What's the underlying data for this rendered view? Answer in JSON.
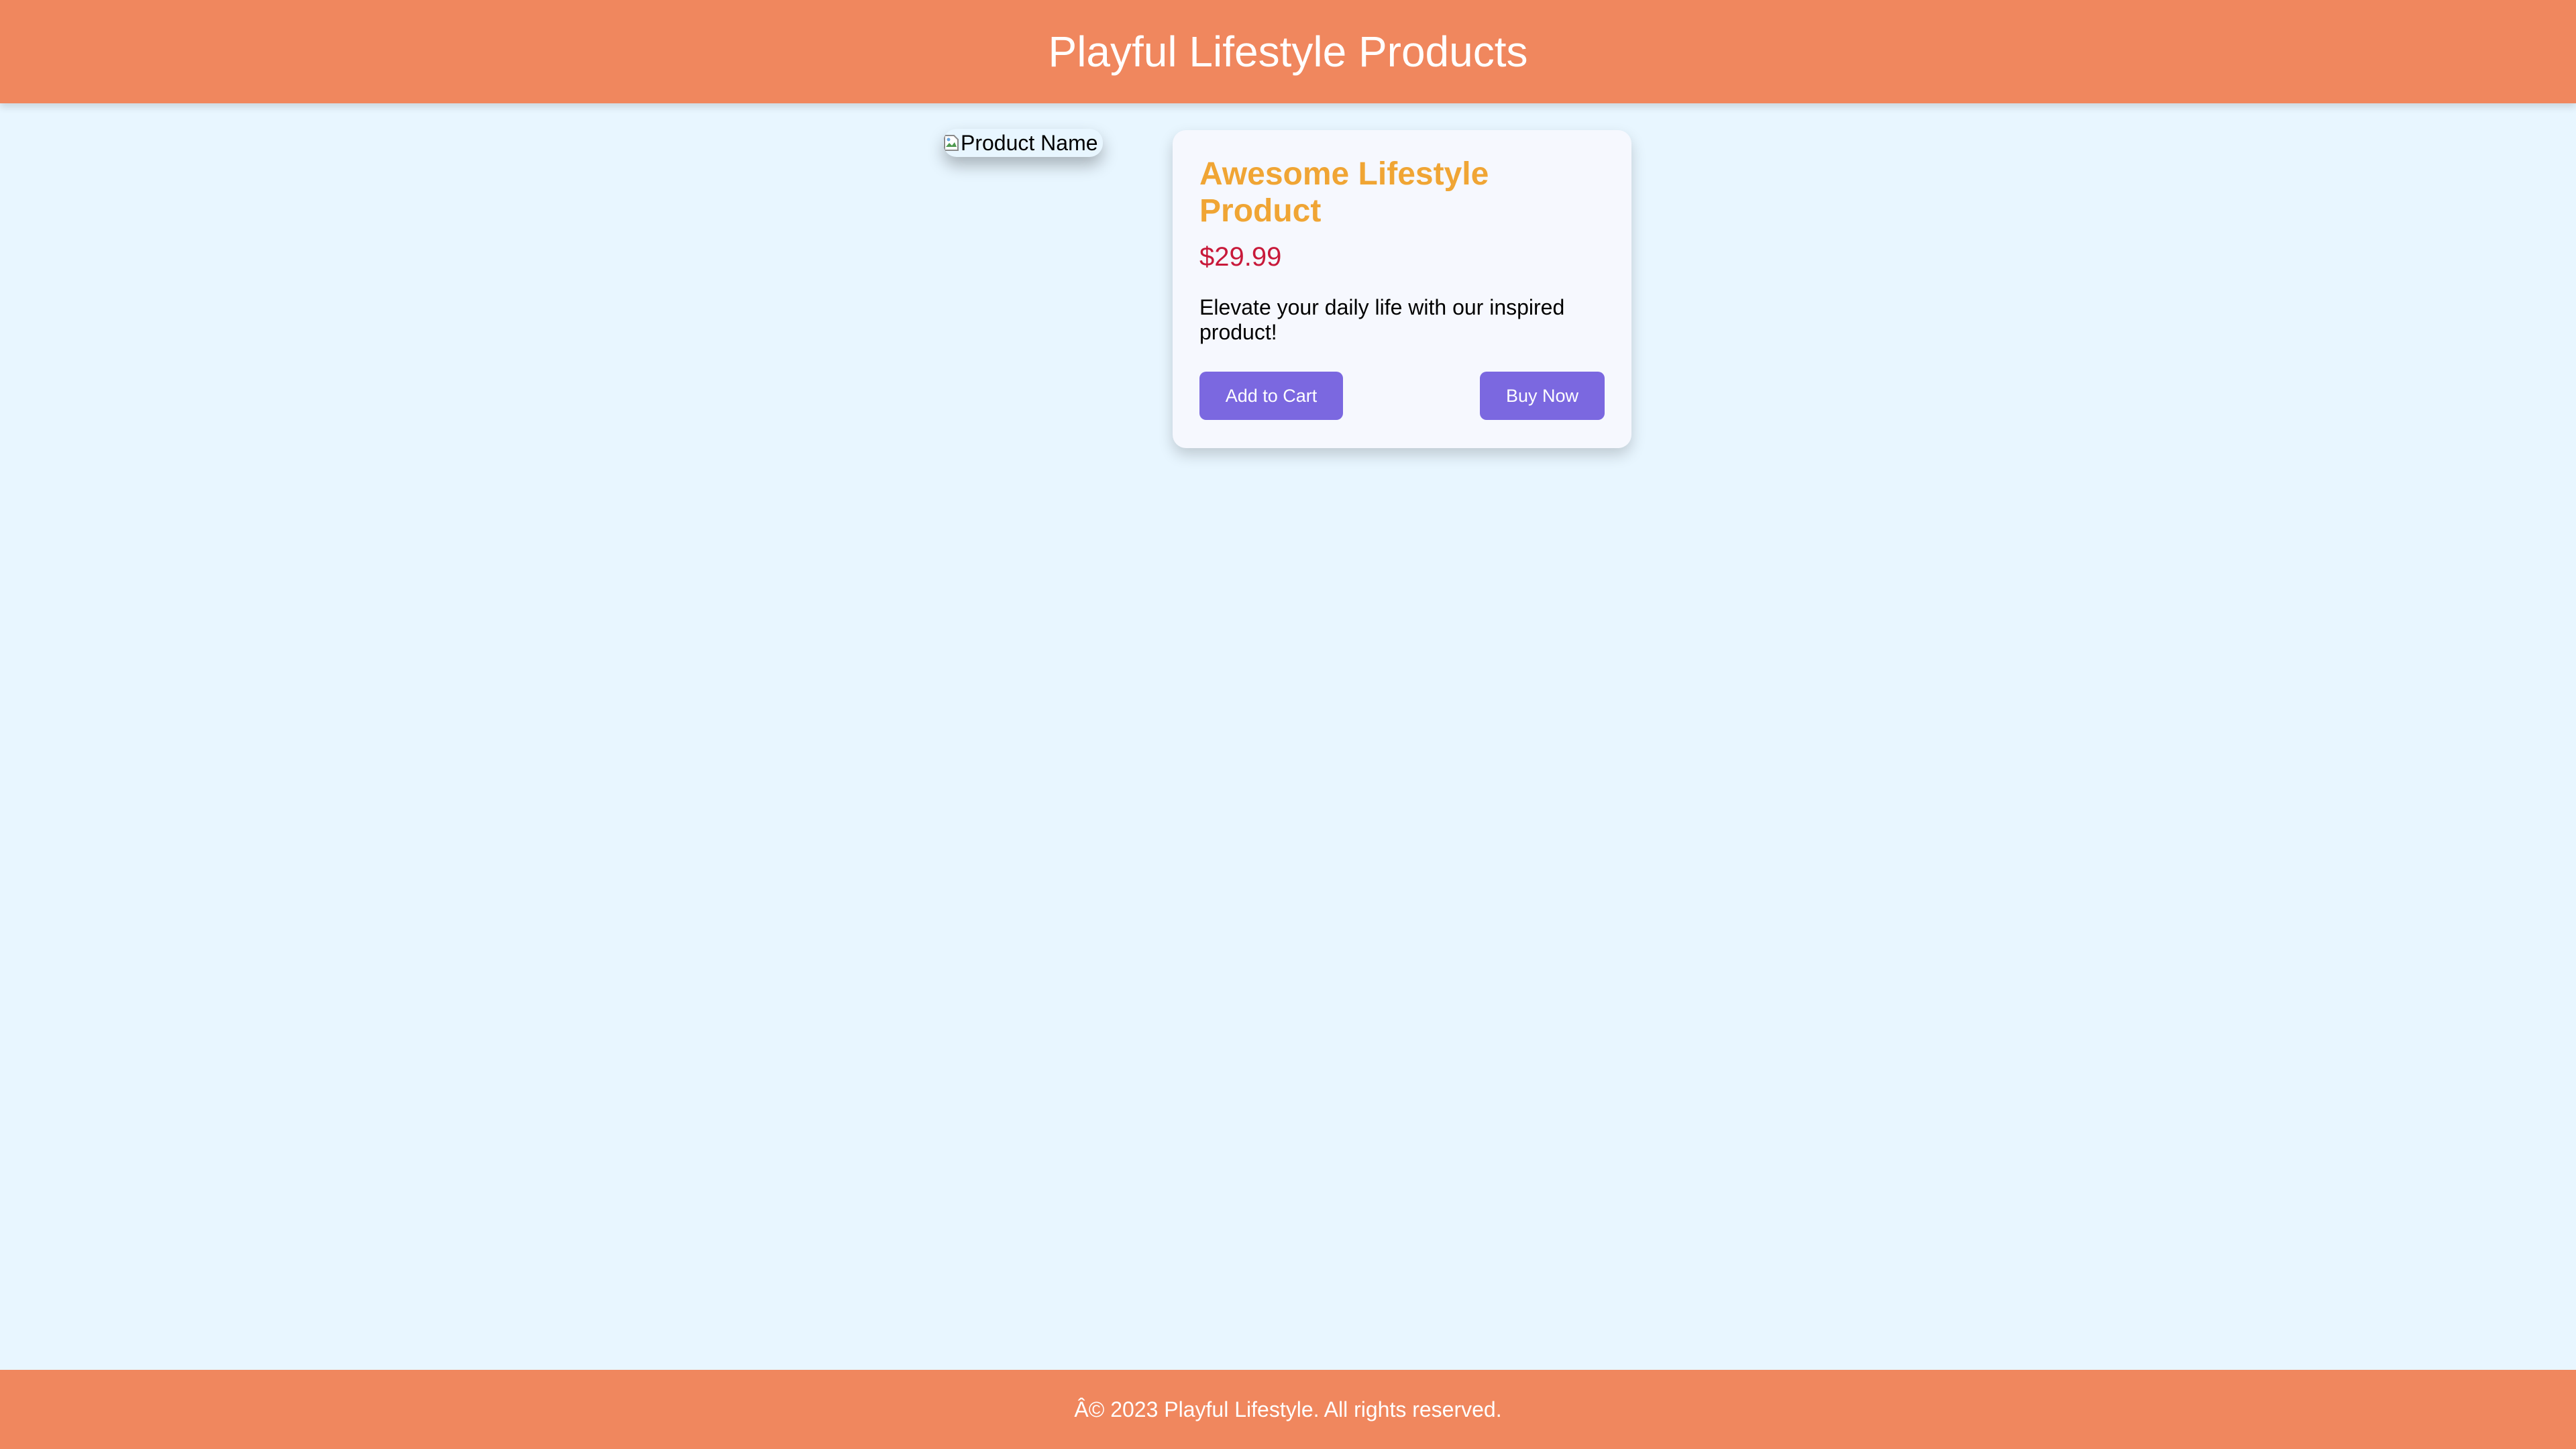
{
  "header": {
    "title": "Playful Lifestyle Products"
  },
  "product": {
    "image_alt": "Product Name",
    "name": "Awesome Lifestyle Product",
    "price": "$29.99",
    "description": "Elevate your daily life with our inspired product!",
    "add_to_cart_label": "Add to Cart",
    "buy_now_label": "Buy Now"
  },
  "footer": {
    "copyright": "Â© 2023 Playful Lifestyle. All rights reserved."
  },
  "icons": {
    "broken_image": "broken-image-icon"
  },
  "colors": {
    "header_footer_bg": "#f0875e",
    "page_bg": "#e8f6ff",
    "card_bg": "#f6f8fe",
    "product_name": "#f0a534",
    "price": "#c8193a",
    "button_bg": "#7b68e0",
    "button_text": "#ffffff"
  }
}
